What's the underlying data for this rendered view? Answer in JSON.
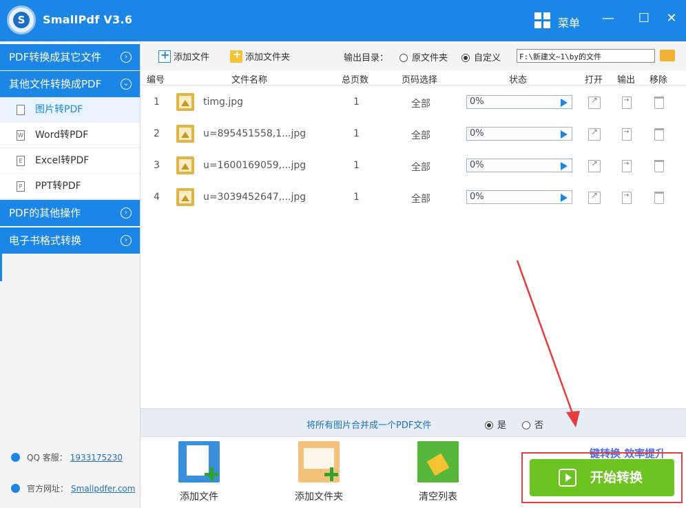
{
  "app": {
    "title": "SmallPdf V3.6",
    "menu_label": "菜单"
  },
  "sidebar": {
    "sections": [
      {
        "label": "PDF转换成其它文件"
      },
      {
        "label": "其他文件转换成PDF"
      },
      {
        "label": "PDF的其他操作"
      },
      {
        "label": "电子书格式转换"
      }
    ],
    "items": [
      {
        "label": "图片转PDF",
        "icon": "image-file-icon"
      },
      {
        "label": "Word转PDF",
        "icon": "word-file-icon"
      },
      {
        "label": "Excel转PDF",
        "icon": "excel-file-icon"
      },
      {
        "label": "PPT转PDF",
        "icon": "ppt-file-icon"
      }
    ],
    "contact": {
      "qq_label": "QQ 客服：",
      "qq_value": "1933175230",
      "site_label": "官方网址：",
      "site_value": "Smallpdfer.com"
    }
  },
  "toolbar": {
    "add_file": "添加文件",
    "add_folder": "添加文件夹",
    "output_label": "输出目录：",
    "opt_original": "原文件夹",
    "opt_custom": "自定义",
    "path_value": "F:\\新建文~1\\by的文件"
  },
  "table": {
    "headers": {
      "no": "编号",
      "name": "文件名称",
      "pages": "总页数",
      "range": "页码选择",
      "status": "状态",
      "open": "打开",
      "output": "输出",
      "remove": "移除"
    },
    "rows": [
      {
        "no": "1",
        "name": "timg.jpg",
        "pages": "1",
        "range": "全部",
        "status": "0%"
      },
      {
        "no": "2",
        "name": "u=895451558,1...jpg",
        "pages": "1",
        "range": "全部",
        "status": "0%"
      },
      {
        "no": "3",
        "name": "u=1600169059,...jpg",
        "pages": "1",
        "range": "全部",
        "status": "0%"
      },
      {
        "no": "4",
        "name": "u=3039452647,...jpg",
        "pages": "1",
        "range": "全部",
        "status": "0%"
      }
    ]
  },
  "merge": {
    "label": "将所有图片合并成一个PDF文件",
    "yes": "是",
    "no": "否"
  },
  "bottom": {
    "add_file": "添加文件",
    "add_folder": "添加文件夹",
    "clear_list": "清空列表",
    "slogan": "键转换  效率提升",
    "start": "开始转换"
  },
  "colors": {
    "accent": "#1c86e6",
    "start": "#6dc31f",
    "highlight": "#e83b3b"
  }
}
